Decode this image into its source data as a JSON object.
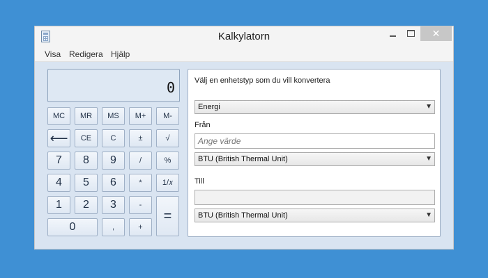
{
  "window": {
    "title": "Kalkylatorn"
  },
  "titlebar": {
    "close_glyph": "✕"
  },
  "menu": [
    "Visa",
    "Redigera",
    "Hjälp"
  ],
  "display": {
    "value": "0"
  },
  "memory_buttons": [
    "MC",
    "MR",
    "MS",
    "M+",
    "M-"
  ],
  "row1": [
    "⟵",
    "CE",
    "C",
    "±",
    "√"
  ],
  "row2": [
    "7",
    "8",
    "9",
    "/",
    "%"
  ],
  "row3": [
    "4",
    "5",
    "6",
    "*",
    "1/𝑥"
  ],
  "row4": [
    "1",
    "2",
    "3",
    "-"
  ],
  "row5": [
    "0",
    ",",
    "+"
  ],
  "equals": "=",
  "converter": {
    "prompt": "Välj en enhetstyp som du vill konvertera",
    "unit_type": "Energi",
    "from_label": "Från",
    "from_placeholder": "Ange värde",
    "from_unit": "BTU (British Thermal Unit)",
    "to_label": "Till",
    "to_value": "",
    "to_unit": "BTU (British Thermal Unit)"
  },
  "icons": {
    "app": "calculator-icon",
    "minimize": "minimize-icon",
    "maximize": "maximize-icon",
    "close": "close-icon",
    "dropdown": "chevron-down-icon"
  },
  "colors": {
    "desktop": "#3f90d4",
    "client": "#d9e4f1",
    "close_button": "#c7c7c7"
  }
}
